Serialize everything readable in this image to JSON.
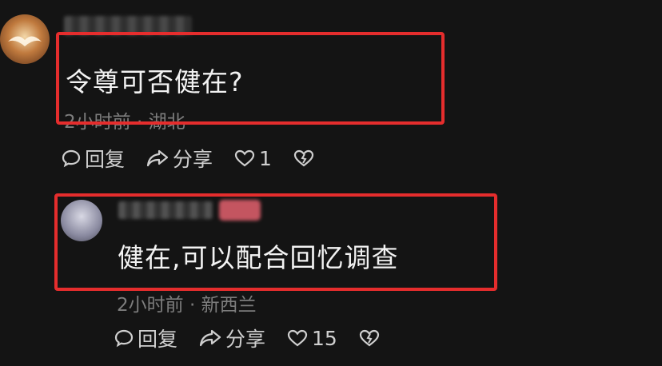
{
  "comments": [
    {
      "text": "令尊可否健在?",
      "meta": "2小时前 · 湖北",
      "reply_label": "回复",
      "share_label": "分享",
      "like_count": "1"
    },
    {
      "text": "健在,可以配合回忆调查",
      "meta": "2小时前 · 新西兰",
      "reply_label": "回复",
      "share_label": "分享",
      "like_count": "15"
    }
  ],
  "colors": {
    "background": "#141414",
    "highlight_box": "#e52d2d",
    "badge": "#ff6b7a"
  },
  "icons": [
    "reply-icon",
    "share-icon",
    "heart-icon",
    "broken-heart-icon"
  ]
}
